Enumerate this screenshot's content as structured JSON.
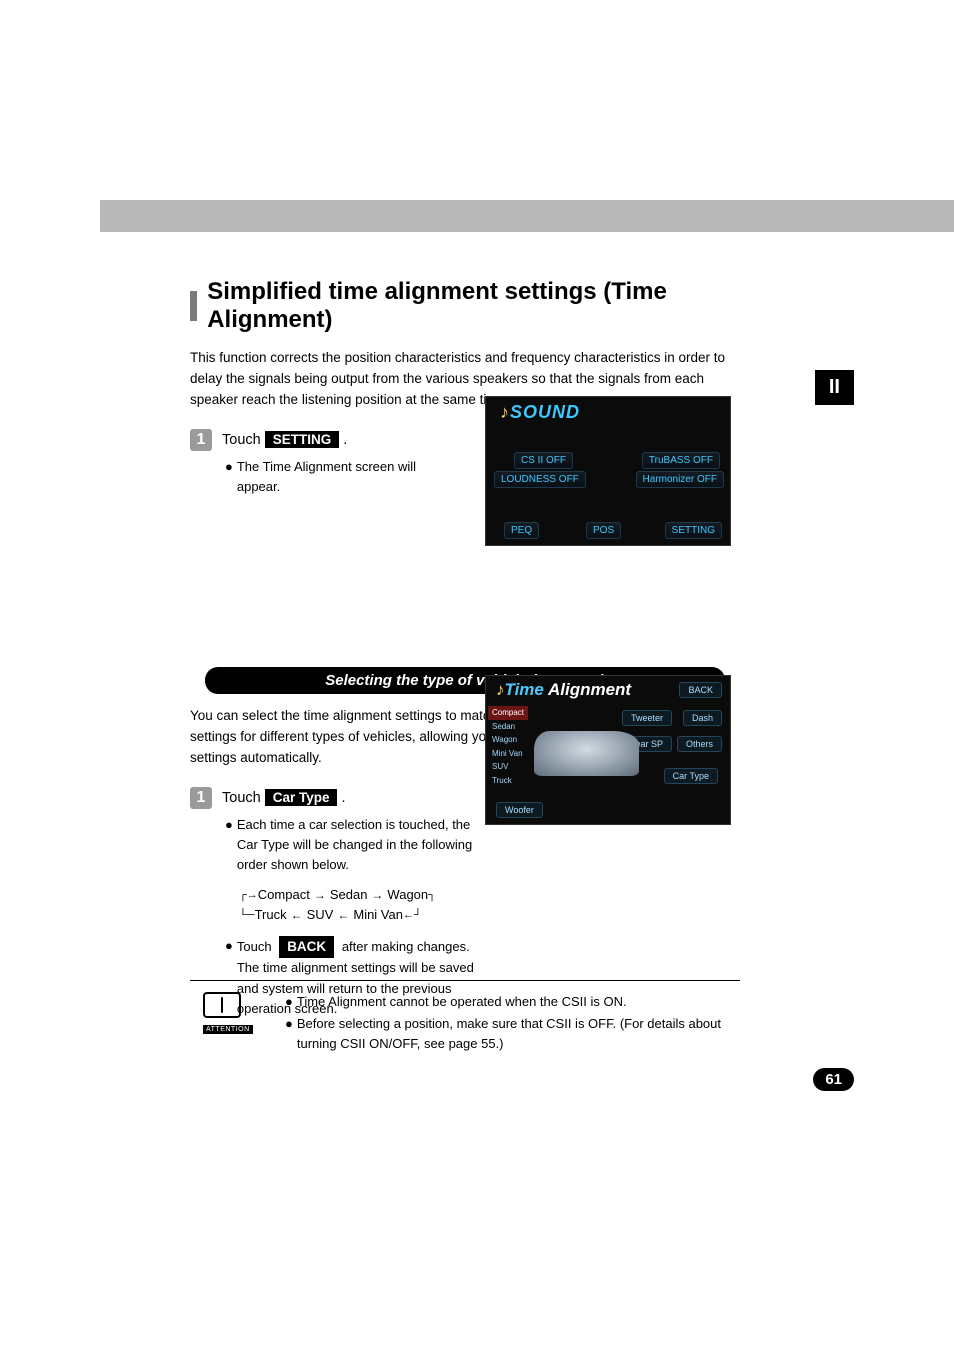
{
  "section_tab": "II",
  "title": "Simplified time alignment settings (Time Alignment)",
  "intro": "This function corrects the position characteristics and frequency characteristics in order to delay the signals being output from the various speakers so that the signals from each speaker reach the listening position at the same time.",
  "step1": {
    "num": "1",
    "touch": "Touch",
    "button": "SETTING",
    "period": ".",
    "body": "The Time Alignment screen will appear."
  },
  "shot1": {
    "sound": "SOUND",
    "csii": "CS II    OFF",
    "trubass": "TruBASS   OFF",
    "loudness": "LOUDNESS  OFF",
    "harmonizer": "Harmonizer OFF",
    "peq": "PEQ",
    "pos": "POS",
    "setting": "SETTING"
  },
  "sub_heading": "Selecting the type of vehicle (Car Type)",
  "sub_intro": "You can select the time alignment settings to match your vehicle from a range of preset settings for different types of vehicles, allowing you to select the optimum time alignment settings automatically.",
  "step2": {
    "num": "1",
    "touch": "Touch",
    "button": "Car Type",
    "period": ".",
    "body1": "Each time a car selection is touched, the Car Type will be changed in the following order shown below.",
    "seq_top": [
      "Compact",
      "Sedan",
      "Wagon"
    ],
    "seq_bottom": [
      "Truck",
      "SUV",
      "Mini Van"
    ],
    "body2_pre": "Touch",
    "body2_btn": "BACK",
    "body2_post": "after making changes. The time alignment settings will be saved and system will return to the previous operation screen."
  },
  "shot2": {
    "title_time": "Time",
    "title_align": "Alignment",
    "back": "BACK",
    "list": [
      "Compact",
      "Sedan",
      "Wagon",
      "Mini Van",
      "SUV",
      "Truck"
    ],
    "woofer": "Woofer",
    "tweeter": "Tweeter",
    "dash": "Dash",
    "rearsp": "Rear SP",
    "others": "Others",
    "cartype": "Car Type"
  },
  "attention": {
    "label": "ATTENTION",
    "line1": "Time Alignment cannot be operated when the CSII is ON.",
    "line2": "Before selecting a position, make sure that CSII is OFF. (For details about turning CSII ON/OFF, see page 55.)"
  },
  "page_num": "61"
}
